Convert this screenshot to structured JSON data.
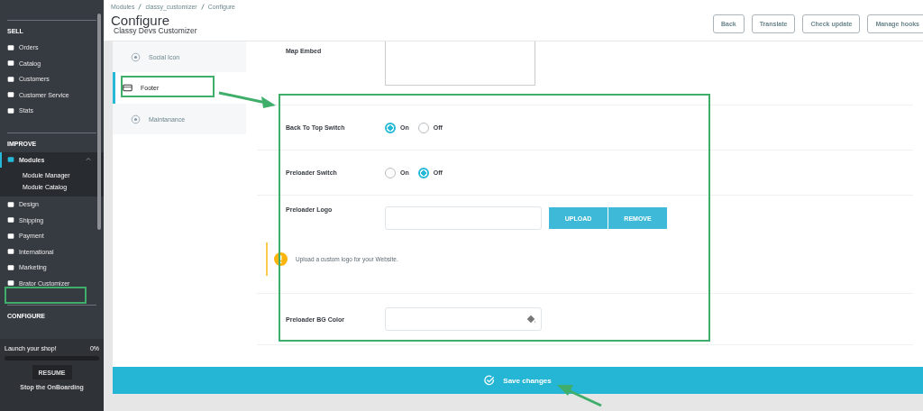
{
  "sidebar": {
    "sections": [
      {
        "title": "SELL",
        "items": [
          {
            "label": "Orders",
            "selected": false
          },
          {
            "label": "Catalog",
            "selected": false
          },
          {
            "label": "Customers",
            "selected": false
          },
          {
            "label": "Customer Service",
            "selected": false
          },
          {
            "label": "Stats",
            "selected": false
          }
        ]
      },
      {
        "title": "IMPROVE",
        "items": [
          {
            "label": "Modules",
            "selected": true,
            "expanded": true,
            "children": [
              {
                "label": "Module Manager"
              },
              {
                "label": "Module Catalog"
              }
            ]
          },
          {
            "label": "Design",
            "selected": false
          },
          {
            "label": "Shipping",
            "selected": false
          },
          {
            "label": "Payment",
            "selected": false
          },
          {
            "label": "International",
            "selected": false
          },
          {
            "label": "Marketing",
            "selected": false
          },
          {
            "label": "Brator Customizer",
            "selected": false
          }
        ]
      },
      {
        "title": "CONFIGURE"
      }
    ],
    "onboarding": {
      "label": "Launch your shop!",
      "percent": "0%",
      "button": "RESUME",
      "link": "Stop the OnBoarding"
    }
  },
  "header": {
    "breadcrumb": [
      "Modules",
      "classy_customizer",
      "Configure"
    ],
    "title": "Configure",
    "subtitle": "Classy Devs Customizer",
    "buttons": [
      "Back",
      "Translate",
      "Check update",
      "Manage hooks"
    ]
  },
  "tabs": [
    {
      "label": "Social Icon",
      "selected": false
    },
    {
      "label": "Footer",
      "selected": true
    },
    {
      "label": "Maintanance",
      "selected": false
    }
  ],
  "form": [
    {
      "kind": "textarea",
      "label": "Map Embed"
    },
    {
      "kind": "radio",
      "label": "Back To Top Switch",
      "options": [
        {
          "label": "On",
          "selected": true
        },
        {
          "label": "Off",
          "selected": false
        }
      ]
    },
    {
      "kind": "radio",
      "label": "Preloader Switch",
      "options": [
        {
          "label": "On",
          "selected": false
        },
        {
          "label": "Off",
          "selected": true
        }
      ]
    },
    {
      "kind": "upload",
      "label": "Preloader Logo",
      "buttons": [
        "UPLOAD",
        "REMOVE"
      ],
      "hint": "Upload a custom logo for your Website."
    },
    {
      "kind": "color",
      "label": "Preloader BG Color"
    }
  ],
  "save_button": "Save changes"
}
